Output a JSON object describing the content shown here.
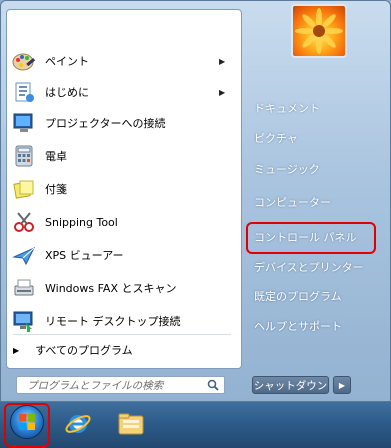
{
  "start_menu": {
    "programs": [
      {
        "label": "ペイント",
        "icon": "paint-icon",
        "has_submenu": true
      },
      {
        "label": "はじめに",
        "icon": "getting-started-icon",
        "has_submenu": true
      },
      {
        "label": "プロジェクターへの接続",
        "icon": "projector-icon",
        "has_submenu": false
      },
      {
        "label": "電卓",
        "icon": "calculator-icon",
        "has_submenu": false
      },
      {
        "label": "付箋",
        "icon": "sticky-notes-icon",
        "has_submenu": false
      },
      {
        "label": "Snipping Tool",
        "icon": "snipping-tool-icon",
        "has_submenu": false
      },
      {
        "label": "XPS ビューアー",
        "icon": "xps-viewer-icon",
        "has_submenu": false
      },
      {
        "label": "Windows FAX とスキャン",
        "icon": "fax-scan-icon",
        "has_submenu": false
      },
      {
        "label": "リモート デスクトップ接続",
        "icon": "remote-desktop-icon",
        "has_submenu": false
      }
    ],
    "all_programs": "すべてのプログラム",
    "search_placeholder": "プログラムとファイルの検索",
    "right_items": [
      {
        "label": "ドキュメント"
      },
      {
        "label": "ピクチャ"
      },
      {
        "label": "ミュージック"
      },
      {
        "label": "コンピューター"
      },
      {
        "label": "コントロール パネル"
      },
      {
        "label": "デバイスとプリンター"
      },
      {
        "label": "既定のプログラム"
      },
      {
        "label": "ヘルプとサポート"
      }
    ],
    "shutdown_label": "シャットダウン",
    "highlight_color": "#e00000"
  },
  "taskbar": {
    "icons": [
      "start-orb-icon",
      "internet-explorer-icon",
      "explorer-folder-icon"
    ]
  }
}
